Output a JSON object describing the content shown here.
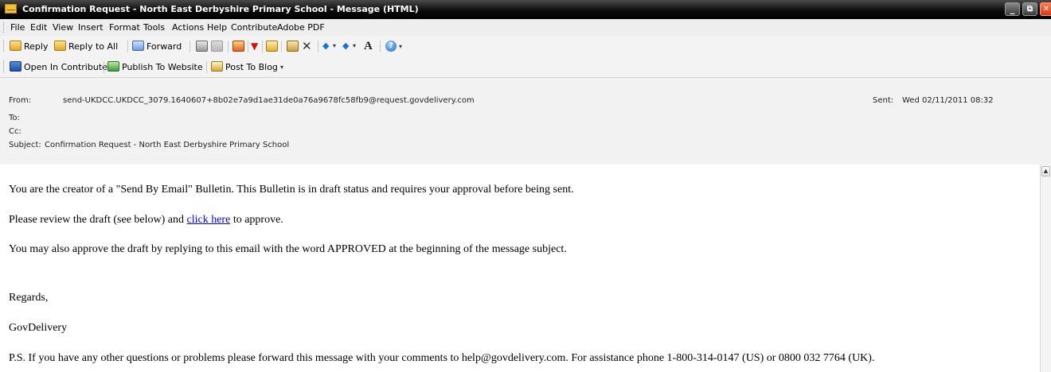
{
  "window": {
    "title": "Confirmation Request - North East Derbyshire Primary School - Message (HTML)",
    "minimize_glyph": "_",
    "maximize_glyph": "⧉",
    "close_glyph": "✕"
  },
  "menu": [
    "File",
    "Edit",
    "View",
    "Insert",
    "Format",
    "Tools",
    "Actions",
    "Help",
    "Contribute",
    "Adobe PDF"
  ],
  "toolbar": {
    "reply": "Reply",
    "reply_all": "Reply to All",
    "forward": "Forward",
    "font_glyph": "A",
    "help_glyph": "?",
    "delete_glyph": "✕",
    "arrow_glyph": "▾",
    "overflow_glyph": "▾"
  },
  "toolbar2": {
    "open_in_contribute": "Open In Contribute",
    "publish_to_website": "Publish To Website",
    "post_to_blog": "Post To Blog"
  },
  "header": {
    "from_label": "From:",
    "from_value": "send-UKDCC.UKDCC_3079.1640607+8b02e7a9d1ae31de0a76a9678fc58fb9@request.govdelivery.com",
    "sent_label": "Sent:",
    "sent_value": "Wed 02/11/2011 08:32",
    "to_label": "To:",
    "cc_label": "Cc:",
    "subject_label": "Subject:",
    "subject_value": "Confirmation Request - North East Derbyshire Primary School"
  },
  "message": {
    "line1": "You are the creator of a \"Send By Email\" Bulletin. This Bulletin is in draft status and requires your approval before being sent.",
    "line2_before": "Please review the draft (see below) and ",
    "line2_link": "click here",
    "line2_after": " to approve.",
    "line3": "You may also approve the draft by replying to this email with the word APPROVED at the beginning of the message subject.",
    "regards": "Regards,",
    "signature": "GovDelivery",
    "ps": "P.S. If you have any other questions or problems please forward this message with your comments to help@govdelivery.com. For assistance phone 1-800-314-0147 (US) or 0800 032 7764 (UK)."
  },
  "scrollbar": {
    "up_glyph": "▲"
  },
  "colors": {
    "title_bar": "#000000",
    "link": "#0000ee",
    "header_bg": "#f2f2f2"
  }
}
